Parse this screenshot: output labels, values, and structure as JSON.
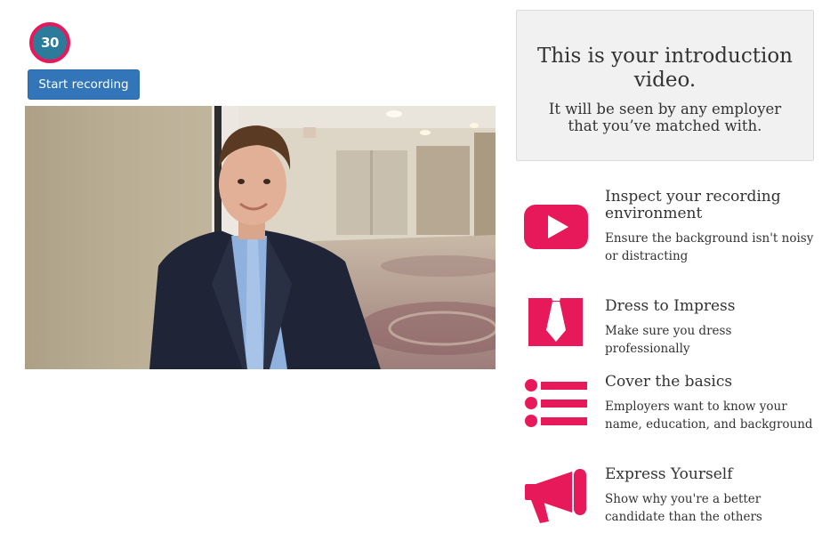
{
  "recorder": {
    "timer_value": "30",
    "start_label": "Start recording"
  },
  "intro": {
    "title": "This is your introduction video.",
    "subtitle": "It will be seen by any employer that you’ve matched with."
  },
  "tips": [
    {
      "icon": "play-icon",
      "title": "Inspect your recording environment",
      "description": "Ensure the background isn't noisy or distracting"
    },
    {
      "icon": "tie-icon",
      "title": "Dress to Impress",
      "description": "Make sure you dress professionally"
    },
    {
      "icon": "list-icon",
      "title": "Cover the basics",
      "description": "Employers want to know your name, education, and background"
    },
    {
      "icon": "megaphone-icon",
      "title": "Express Yourself",
      "description": "Show why you're a better candidate than the others"
    }
  ],
  "colors": {
    "accent": "#e8195a",
    "button": "#3276b9",
    "timer_fill": "#2d7b9b",
    "panel": "#f1f1f1"
  }
}
